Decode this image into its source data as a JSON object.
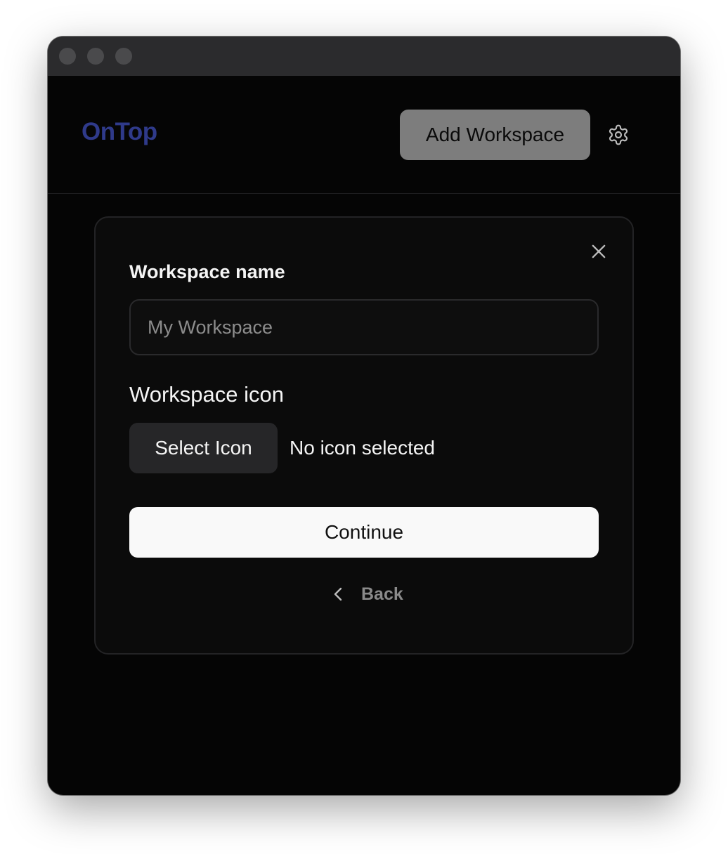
{
  "header": {
    "logo_text": "OnTop",
    "add_workspace_label": "Add Workspace"
  },
  "dialog": {
    "name_label": "Workspace name",
    "name_input": {
      "value": "",
      "placeholder": "My Workspace"
    },
    "icon_label": "Workspace icon",
    "select_icon_label": "Select Icon",
    "icon_status": "No icon selected",
    "continue_label": "Continue",
    "back_label": "Back"
  },
  "icons": {
    "settings": "gear-icon",
    "close": "close-icon",
    "back": "chevron-left-icon"
  },
  "colors": {
    "brand": "#2f3a8a",
    "window_bg": "#050505",
    "primary_button": "#f9f9f9",
    "secondary_button": "#262628",
    "header_button": "#7d7d7d"
  }
}
